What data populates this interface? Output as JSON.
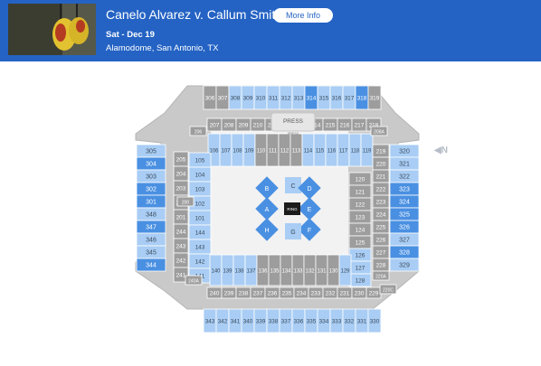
{
  "event": {
    "title": "Canelo Alvarez v. Callum Smith",
    "more_info_label": "More Info",
    "date": "Sat - Dec 19",
    "venue": "Alamodome, San Antonio, TX"
  },
  "compass": {
    "label": "N"
  },
  "colors": {
    "header": "#2463c4",
    "section_available": "#a9cdf4",
    "section_selected": "#4a90e2",
    "section_unavailable": "#9d9d9d"
  },
  "floor": {
    "press_label": "PRESS",
    "press_sub": "PRESS",
    "ring_label": "RING",
    "pods": [
      "A",
      "B",
      "C",
      "D",
      "E",
      "F",
      "G",
      "H"
    ]
  },
  "sections": {
    "top_300": [
      "306",
      "307",
      "308",
      "309",
      "310",
      "311",
      "312",
      "313",
      "314",
      "315",
      "316",
      "317",
      "318",
      "319"
    ],
    "top_200": [
      "207",
      "208",
      "209",
      "210",
      "211",
      "212",
      "213",
      "214",
      "215",
      "216",
      "217",
      "218"
    ],
    "top_100": [
      "106",
      "107",
      "108",
      "109",
      "110",
      "111",
      "112",
      "113",
      "114",
      "115",
      "116",
      "117",
      "118",
      "119"
    ],
    "left_300": [
      "305",
      "304",
      "303",
      "302",
      "301",
      "348",
      "347",
      "346",
      "345",
      "344"
    ],
    "left_200": [
      "205",
      "204",
      "203",
      "202",
      "201",
      "244",
      "243",
      "242",
      "241"
    ],
    "left_100": [
      "105",
      "104",
      "103",
      "102",
      "101",
      "144",
      "143",
      "142",
      "141"
    ],
    "right_100": [
      "120",
      "121",
      "122",
      "123",
      "124",
      "125",
      "126",
      "127",
      "128"
    ],
    "right_200": [
      "219",
      "220",
      "221",
      "222",
      "223",
      "224",
      "225",
      "226",
      "227",
      "228"
    ],
    "right_300": [
      "320",
      "321",
      "322",
      "323",
      "324",
      "325",
      "326",
      "327",
      "328",
      "329"
    ],
    "bottom_100": [
      "140",
      "139",
      "138",
      "137",
      "136",
      "135",
      "134",
      "133",
      "132",
      "131",
      "130",
      "129"
    ],
    "bottom_200": [
      "240",
      "239",
      "238",
      "237",
      "236",
      "235",
      "234",
      "233",
      "232",
      "231",
      "230",
      "229"
    ],
    "bottom_300": [
      "343",
      "342",
      "341",
      "340",
      "339",
      "338",
      "337",
      "336",
      "335",
      "334",
      "333",
      "332",
      "331",
      "330"
    ],
    "corners": [
      "206",
      "208A",
      "200",
      "220A",
      "220C",
      "240A"
    ]
  }
}
